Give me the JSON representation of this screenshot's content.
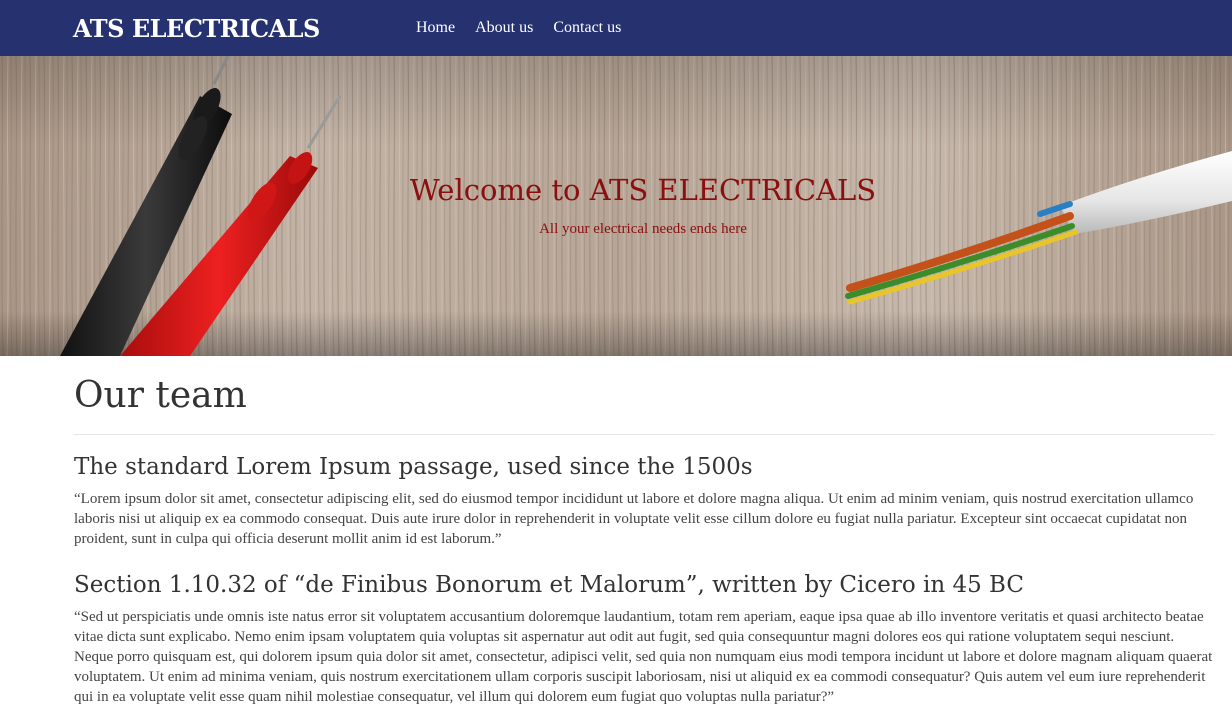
{
  "navbar": {
    "brand": "ATS ELECTRICALS",
    "links": [
      {
        "label": "Home"
      },
      {
        "label": "About us"
      },
      {
        "label": "Contact us"
      }
    ],
    "background": "#263170"
  },
  "hero": {
    "title": "Welcome to ATS ELECTRICALS",
    "subtitle": "All your electrical needs ends here",
    "text_color": "#8b0f0f"
  },
  "main": {
    "title": "Our team",
    "sections": [
      {
        "heading": "The standard Lorem Ipsum passage, used since the 1500s",
        "text": "“Lorem ipsum dolor sit amet, consectetur adipiscing elit, sed do eiusmod tempor incididunt ut labore et dolore magna aliqua. Ut enim ad minim veniam, quis nostrud exercitation ullamco laboris nisi ut aliquip ex ea commodo consequat. Duis aute irure dolor in reprehenderit in voluptate velit esse cillum dolore eu fugiat nulla pariatur. Excepteur sint occaecat cupidatat non proident, sunt in culpa qui officia deserunt mollit anim id est laborum.”"
      },
      {
        "heading": "Section 1.10.32 of “de Finibus Bonorum et Malorum”, written by Cicero in 45 BC",
        "text": "“Sed ut perspiciatis unde omnis iste natus error sit voluptatem accusantium doloremque laudantium, totam rem aperiam, eaque ipsa quae ab illo inventore veritatis et quasi architecto beatae vitae dicta sunt explicabo. Nemo enim ipsam voluptatem quia voluptas sit aspernatur aut odit aut fugit, sed quia consequuntur magni dolores eos qui ratione voluptatem sequi nesciunt. Neque porro quisquam est, qui dolorem ipsum quia dolor sit amet, consectetur, adipisci velit, sed quia non numquam eius modi tempora incidunt ut labore et dolore magnam aliquam quaerat voluptatem. Ut enim ad minima veniam, quis nostrum exercitationem ullam corporis suscipit laboriosam, nisi ut aliquid ex ea commodi consequatur? Quis autem vel eum iure reprehenderit qui in ea voluptate velit esse quam nihil molestiae consequatur, vel illum qui dolorem eum fugiat quo voluptas nulla pariatur?”"
      }
    ]
  }
}
